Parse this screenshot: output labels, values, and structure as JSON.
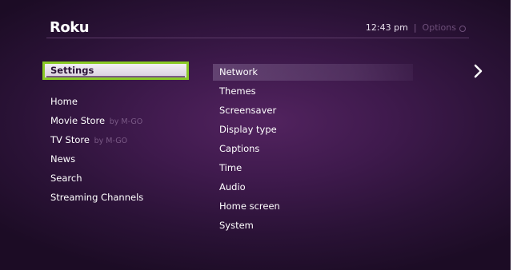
{
  "header": {
    "logo": "Roku",
    "time": "12:43 pm",
    "separator": "|",
    "options_label": "Options"
  },
  "left_menu": {
    "selected": "Settings",
    "items": [
      {
        "label": "Home",
        "by": ""
      },
      {
        "label": "Movie Store",
        "by": "by M-GO"
      },
      {
        "label": "TV Store",
        "by": "by M-GO"
      },
      {
        "label": "News",
        "by": ""
      },
      {
        "label": "Search",
        "by": ""
      },
      {
        "label": "Streaming Channels",
        "by": ""
      }
    ]
  },
  "submenu": {
    "items": [
      "Network",
      "Themes",
      "Screensaver",
      "Display type",
      "Captions",
      "Time",
      "Audio",
      "Home screen",
      "System"
    ]
  },
  "colors": {
    "background": "#3f1a4d",
    "focus_border": "#8ac926",
    "muted_text": "#7a5a86"
  },
  "icons": {
    "options": "options-star-icon",
    "next": "chevron-right-icon"
  }
}
